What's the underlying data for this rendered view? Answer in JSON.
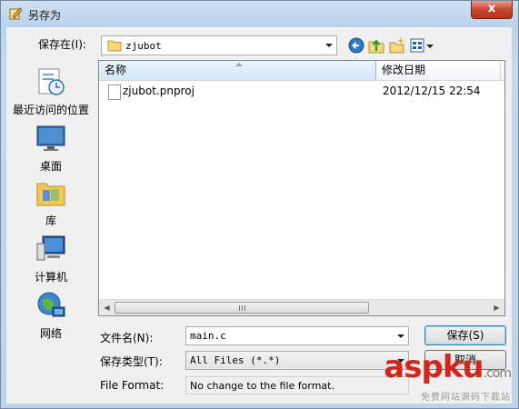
{
  "window": {
    "title": "另存为",
    "close_glyph": "x"
  },
  "location": {
    "label": "保存在(I):",
    "folder": "zjubot"
  },
  "toolbar": {
    "icons": [
      "back-icon",
      "up-folder-icon",
      "new-folder-icon",
      "view-menu-icon"
    ]
  },
  "places": [
    {
      "label": "最近访问的位置",
      "icon": "recent-places-icon"
    },
    {
      "label": "桌面",
      "icon": "desktop-icon"
    },
    {
      "label": "库",
      "icon": "libraries-icon"
    },
    {
      "label": "计算机",
      "icon": "computer-icon"
    },
    {
      "label": "网络",
      "icon": "network-icon"
    }
  ],
  "file_list": {
    "columns": [
      "名称",
      "修改日期"
    ],
    "rows": [
      {
        "name": "zjubot.pnproj",
        "modified": "2012/12/15 22:54"
      }
    ]
  },
  "form": {
    "filename_label": "文件名(N):",
    "filename_value": "main.c",
    "filetype_label": "保存类型(T):",
    "filetype_value": "All Files (*.*)",
    "format_label": "File Format:",
    "format_value": "No change to the file format."
  },
  "buttons": {
    "save": "保存(S)",
    "cancel": "取消"
  },
  "watermark": {
    "main": "aspku",
    "suffix": ".com",
    "tagline": "免费网站源码下载站"
  }
}
